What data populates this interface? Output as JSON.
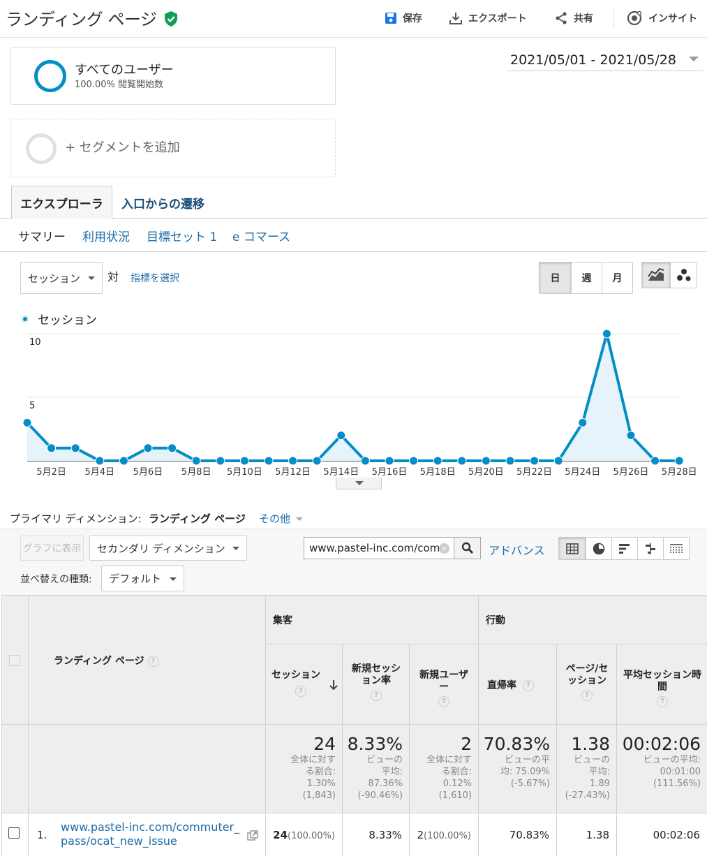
{
  "header": {
    "title": "ランディング ページ",
    "save": "保存",
    "export": "エクスポート",
    "share": "共有",
    "insight": "インサイト"
  },
  "segments": {
    "all_users": "すべてのユーザー",
    "all_users_sub": "100.00% 閲覧開始数",
    "add": "+ セグメントを追加"
  },
  "date_range": "2021/05/01 - 2021/05/28",
  "tabs": [
    "エクスプローラ",
    "入口からの遷移"
  ],
  "subtabs": [
    "サマリー",
    "利用状況",
    "目標セット 1",
    "e コマース"
  ],
  "chart_controls": {
    "metric": "セッション",
    "vs": "対",
    "choose_metric": "指標を選択",
    "day": "日",
    "week": "週",
    "month": "月"
  },
  "chart_data": {
    "type": "area",
    "series": [
      {
        "name": "セッション",
        "values": [
          3,
          1,
          1,
          0,
          0,
          1,
          1,
          0,
          0,
          0,
          0,
          0,
          0,
          2,
          0,
          0,
          0,
          0,
          0,
          0,
          0,
          0,
          0,
          3,
          10,
          2,
          0,
          0
        ]
      }
    ],
    "x": [
      "5月1日",
      "5月2日",
      "5月3日",
      "5月4日",
      "5月5日",
      "5月6日",
      "5月7日",
      "5月8日",
      "5月9日",
      "5月10日",
      "5月11日",
      "5月12日",
      "5月13日",
      "5月14日",
      "5月15日",
      "5月16日",
      "5月17日",
      "5月18日",
      "5月19日",
      "5月20日",
      "5月21日",
      "5月22日",
      "5月23日",
      "5月24日",
      "5月25日",
      "5月26日",
      "5月27日",
      "5月28日"
    ],
    "x_tick_labels": [
      "5月2日",
      "5月4日",
      "5月6日",
      "5月8日",
      "5月10日",
      "5月12日",
      "5月14日",
      "5月16日",
      "5月18日",
      "5月20日",
      "5月22日",
      "5月24日",
      "5月26日",
      "5月28日"
    ],
    "y_ticks": [
      5,
      10
    ],
    "ylim": [
      0,
      10
    ],
    "color": "#058dc7",
    "fill": "#e6f3fa",
    "grid": true,
    "legend": "top-left"
  },
  "dimension": {
    "label": "プライマリ ディメンション:",
    "value": "ランディング ページ",
    "other": "その他"
  },
  "toolbar": {
    "plot": "グラフに表示",
    "secondary": "セカンダリ ディメンション",
    "search_value": "www.pastel-inc.com/com",
    "advanced": "アドバンス",
    "sort_label": "並べ替えの種類:",
    "sort_value": "デフォルト"
  },
  "table": {
    "dim_header": "ランディング ページ",
    "group_acq": "集客",
    "group_beh": "行動",
    "columns": [
      "セッション",
      "新規セッション率",
      "新規ユーザー",
      "直帰率",
      "ページ/セッション",
      "平均セッション時間"
    ],
    "totals": [
      {
        "value": "24",
        "sub": [
          "全体に対す",
          "る割合:",
          "1.30%",
          "(1,843)"
        ]
      },
      {
        "value": "8.33%",
        "sub": [
          "ビューの",
          "平均:",
          "87.36%",
          "(-90.46%)"
        ]
      },
      {
        "value": "2",
        "sub": [
          "全体に対す",
          "る割合:",
          "0.12%",
          "(1,610)"
        ]
      },
      {
        "value": "70.83%",
        "sub": [
          "ビューの平",
          "均: 75.09%",
          "(-5.67%)"
        ]
      },
      {
        "value": "1.38",
        "sub": [
          "ビューの",
          "平均:",
          "1.89",
          "(-27.43%)"
        ]
      },
      {
        "value": "00:02:06",
        "sub": [
          "ビューの平均:",
          "00:01:00",
          "(111.56%)"
        ]
      }
    ],
    "rows": [
      {
        "index": "1.",
        "page": "www.pastel-inc.com/commuter_pass/ocat_new_issue",
        "sessions": "24",
        "sessions_pct": "(100.00%)",
        "new_session_rate": "8.33%",
        "new_users": "2",
        "new_users_pct": "(100.00%)",
        "bounce_rate": "70.83%",
        "pages_per_session": "1.38",
        "avg_duration": "00:02:06"
      }
    ]
  }
}
